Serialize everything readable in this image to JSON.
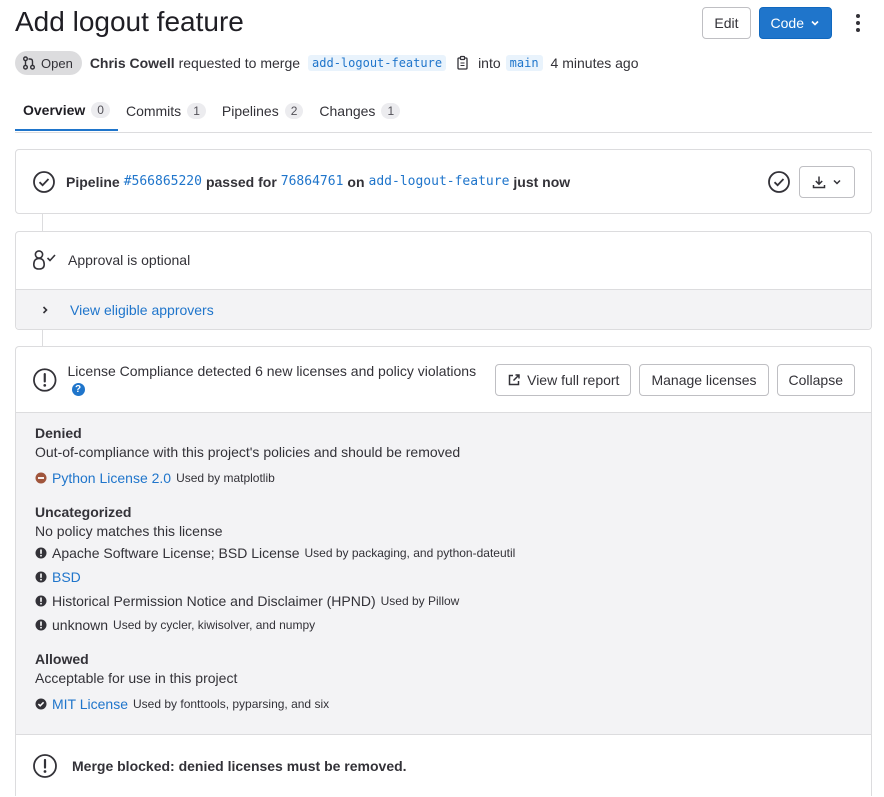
{
  "header": {
    "title": "Add logout feature",
    "edit_label": "Edit",
    "code_label": "Code"
  },
  "meta": {
    "status": "Open",
    "author": "Chris Cowell",
    "requested_text": "requested to merge",
    "source_branch": "add-logout-feature",
    "into_text": "into",
    "target_branch": "main",
    "time": "4 minutes ago"
  },
  "tabs": [
    {
      "label": "Overview",
      "count": "0"
    },
    {
      "label": "Commits",
      "count": "1"
    },
    {
      "label": "Pipelines",
      "count": "2"
    },
    {
      "label": "Changes",
      "count": "1"
    }
  ],
  "pipeline": {
    "prefix": "Pipeline",
    "id": "#566865220",
    "passed_for": "passed for",
    "commit": "76864761",
    "on": "on",
    "branch": "add-logout-feature",
    "when": "just now"
  },
  "approval": {
    "text": "Approval is optional",
    "view_label": "View eligible approvers"
  },
  "license": {
    "summary": "License Compliance detected 6 new licenses and policy violations",
    "help": "?",
    "view_report": "View full report",
    "manage": "Manage licenses",
    "collapse": "Collapse",
    "groups": {
      "denied": {
        "title": "Denied",
        "desc": "Out-of-compliance with this project's policies and should be removed",
        "items": [
          {
            "name": "Python License 2.0",
            "used": "Used by matplotlib",
            "is_link": true
          }
        ]
      },
      "uncategorized": {
        "title": "Uncategorized",
        "desc": "No policy matches this license",
        "items": [
          {
            "name": "Apache Software License; BSD License",
            "used": "Used by packaging, and python-dateutil",
            "is_link": false
          },
          {
            "name": "BSD",
            "used": "",
            "is_link": true
          },
          {
            "name": "Historical Permission Notice and Disclaimer (HPND)",
            "used": "Used by Pillow",
            "is_link": false
          },
          {
            "name": "unknown",
            "used": "Used by cycler, kiwisolver, and numpy",
            "is_link": false
          }
        ]
      },
      "allowed": {
        "title": "Allowed",
        "desc": "Acceptable for use in this project",
        "items": [
          {
            "name": "MIT License",
            "used": "Used by fonttools, pyparsing, and six",
            "is_link": true
          }
        ]
      }
    },
    "merge_blocked": "Merge blocked: denied licenses must be removed."
  },
  "colors": {
    "accent": "#1f75cb",
    "denied": "#a0553c",
    "warning": "#333238"
  }
}
